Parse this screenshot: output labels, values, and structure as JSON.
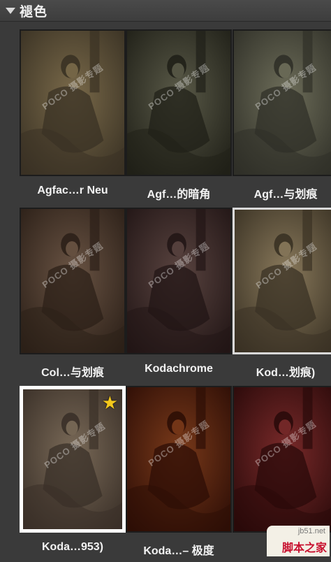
{
  "panel": {
    "title": "褪色"
  },
  "watermark": "POCO 摄影专题",
  "presets": [
    {
      "label": "Agfac…r Neu",
      "tint": "#7a6a4a",
      "shade": "#3a3224",
      "style": "normal"
    },
    {
      "label": "Agf…的暗角",
      "tint": "#5a5a48",
      "shade": "#202018",
      "style": "normal"
    },
    {
      "label": "Agf…与划痕",
      "tint": "#6e6e5a",
      "shade": "#303028",
      "style": "normal"
    },
    {
      "label": "Col…与划痕",
      "tint": "#6a5444",
      "shade": "#2c2018",
      "style": "normal"
    },
    {
      "label": "Kodachrome",
      "tint": "#5a4440",
      "shade": "#221616",
      "style": "normal"
    },
    {
      "label": "Kod…划痕)",
      "tint": "#8a7a5c",
      "shade": "#3a3224",
      "style": "highlight"
    },
    {
      "label": "Koda…953)",
      "tint": "#7a6a58",
      "shade": "#3a3028",
      "style": "selected",
      "starred": true
    },
    {
      "label": "Koda…– 极度",
      "tint": "#7a3a1a",
      "shade": "#2e0e06",
      "style": "normal"
    },
    {
      "label": "",
      "tint": "#7a2a2a",
      "shade": "#2a0a0a",
      "style": "normal"
    }
  ],
  "footer_watermark": {
    "url": "jb51.net",
    "brand": "脚本之家"
  }
}
